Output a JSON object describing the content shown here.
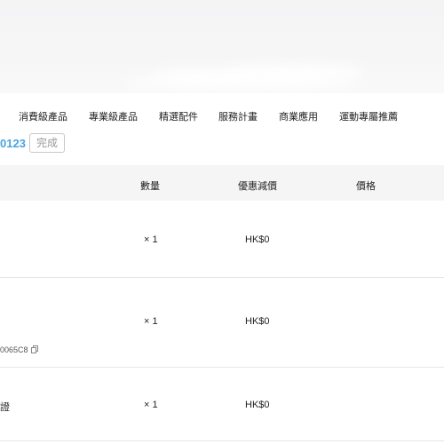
{
  "nav": {
    "items": [
      "消費級產品",
      "專業級產品",
      "精選配件",
      "服務計畫",
      "商業應用",
      "運動專屬推薦"
    ]
  },
  "order": {
    "id_partial": "0123",
    "status": "完成"
  },
  "table": {
    "headers": {
      "quantity": "數量",
      "discount": "優惠減價",
      "price": "價格"
    },
    "rows": [
      {
        "name_partial": "",
        "quantity": "× 1",
        "discount": "HK$0",
        "serial": ""
      },
      {
        "name_partial": "",
        "quantity": "× 1",
        "discount": "HK$0",
        "serial": "0065C8"
      },
      {
        "name_partial": "證",
        "quantity": "× 1",
        "discount": "HK$0",
        "serial": ""
      }
    ]
  },
  "icons": {
    "copy": "copy-icon"
  }
}
